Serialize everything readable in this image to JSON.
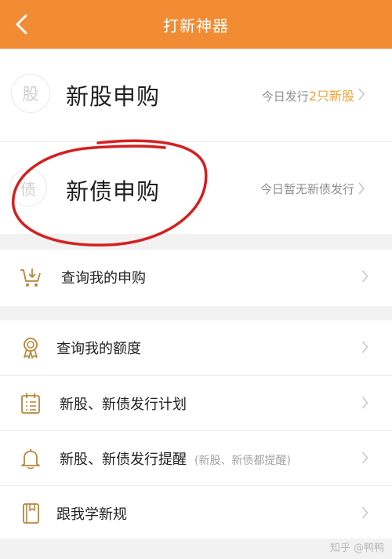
{
  "header": {
    "title": "打新神器"
  },
  "ipo": {
    "stock": {
      "badge": "股",
      "title": "新股申购",
      "status_prefix": "今日发行",
      "status_highlight": "2只新股"
    },
    "bond": {
      "badge": "债",
      "title": "新债申购",
      "status": "今日暂无新债发行"
    }
  },
  "menu": {
    "query_subscription": "查询我的申购",
    "query_quota": "查询我的额度",
    "issue_plan": "新股、新债发行计划",
    "issue_reminder": "新股、新债发行提醒",
    "issue_reminder_note": "(新股、新债都提醒)",
    "learn_rules": "跟我学新规"
  },
  "watermark": "知乎 @鸭鸭",
  "colors": {
    "accent": "#f28c34",
    "highlight": "#f0a43b",
    "icon_gold": "#b9853a",
    "annotation": "#d61f1f"
  }
}
